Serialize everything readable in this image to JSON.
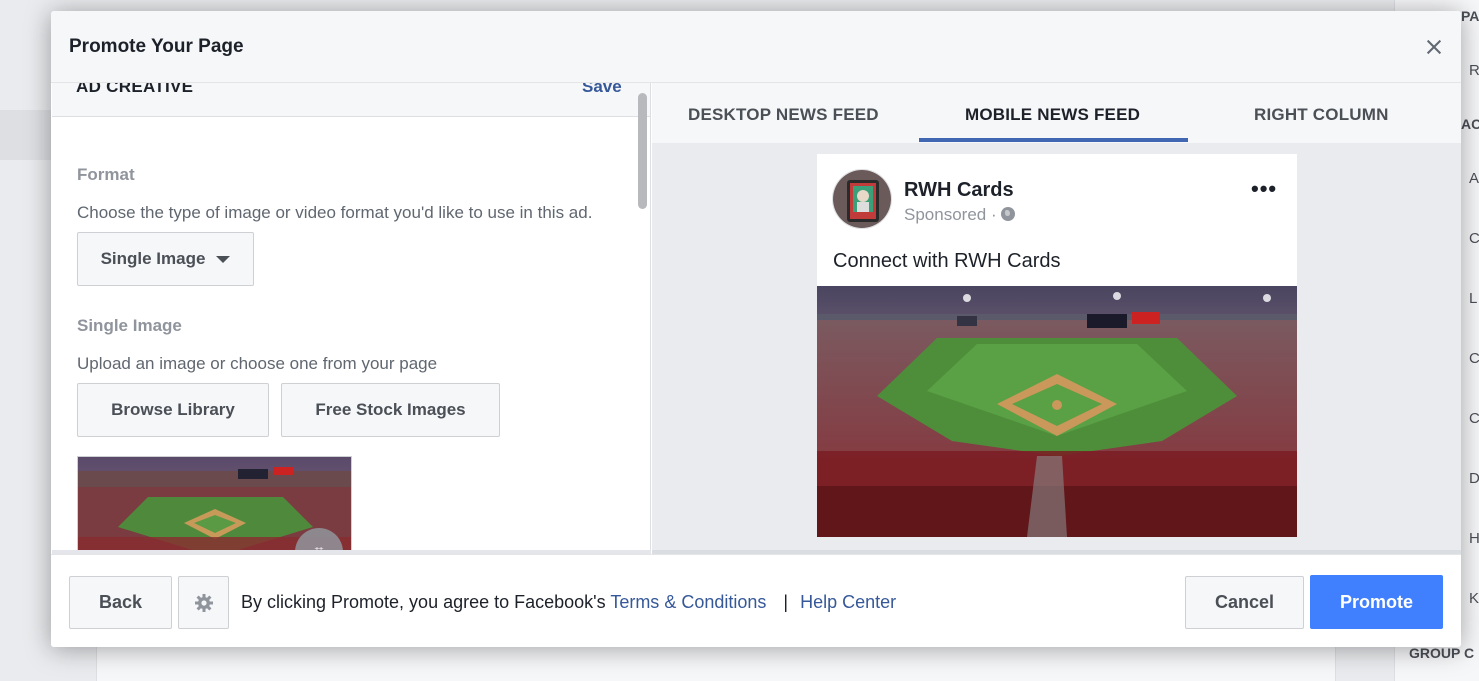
{
  "modal": {
    "title": "Promote Your Page"
  },
  "left_panel": {
    "section_title": "AD CREATIVE",
    "save_label": "Save",
    "format_label": "Format",
    "format_desc": "Choose the type of image or video format you'd like to use in this ad.",
    "format_selected": "Single Image",
    "image_label": "Single Image",
    "image_desc": "Upload an image or choose one from your page",
    "browse_label": "Browse Library",
    "stock_label": "Free Stock Images"
  },
  "tabs": [
    {
      "label": "DESKTOP NEWS FEED"
    },
    {
      "label": "MOBILE NEWS FEED",
      "active": true
    },
    {
      "label": "RIGHT COLUMN"
    }
  ],
  "preview": {
    "page_name": "RWH Cards",
    "sponsored": "Sponsored ·",
    "post_text": "Connect with RWH Cards"
  },
  "footer": {
    "back_label": "Back",
    "legal_prefix": "By clicking Promote, you agree to Facebook's",
    "terms_label": "Terms & Conditions",
    "separator": "|",
    "help_label": "Help Center",
    "cancel_label": "Cancel",
    "promote_label": "Promote"
  },
  "background_sidebar": {
    "items": [
      "PA",
      "R",
      "ACT",
      "A",
      "C",
      "L",
      "C",
      "C",
      "D",
      "H",
      "K"
    ],
    "footer_heading": "GROUP C"
  },
  "colors": {
    "accent": "#4080ff",
    "link": "#365899",
    "tab_indicator": "#4267b2"
  }
}
